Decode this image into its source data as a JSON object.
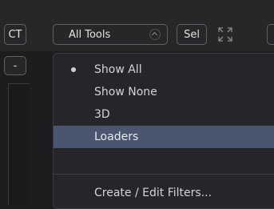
{
  "toolbar": {
    "ct_label": "CT",
    "filter_label": "All Tools",
    "sel_label": "Sel"
  },
  "side": {
    "minus_label": "-"
  },
  "menu": {
    "items": [
      {
        "label": "Show All",
        "checked": true
      },
      {
        "label": "Show None",
        "checked": false
      },
      {
        "label": "3D",
        "checked": false
      },
      {
        "label": "Loaders",
        "checked": false,
        "highlighted": true
      },
      {
        "label": "Create / Edit Filters...",
        "checked": false
      }
    ]
  },
  "colors": {
    "background": "#1d1d1f",
    "menu_background": "#25252a",
    "highlight": "#4a5570",
    "border": "#606066"
  },
  "icons": [
    "chevron-up-icon",
    "expand-icon",
    "bullet-icon"
  ]
}
